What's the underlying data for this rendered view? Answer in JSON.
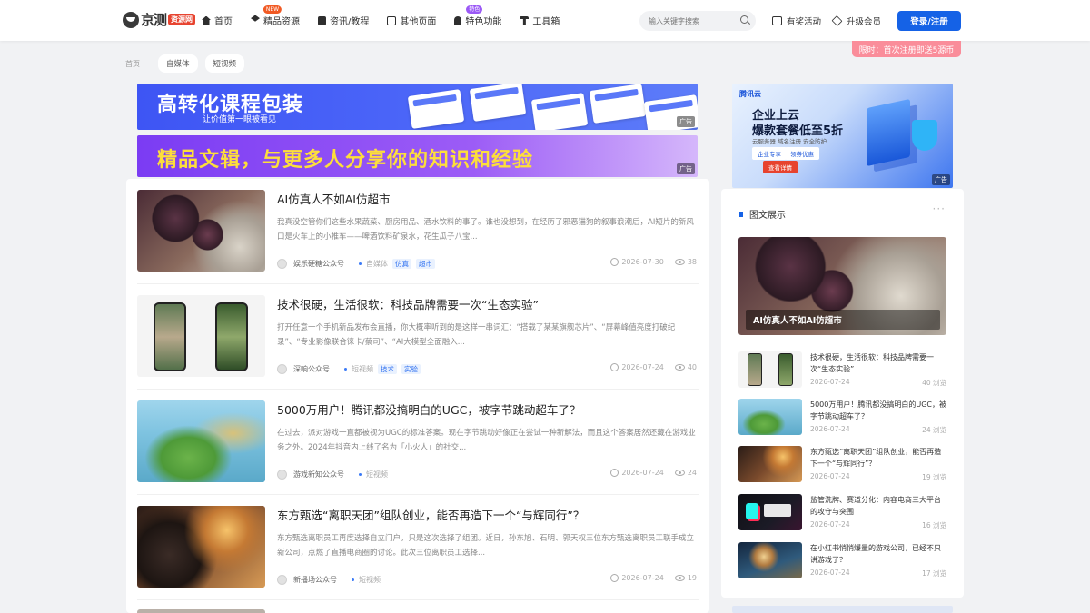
{
  "header": {
    "logo_text": "京测",
    "logo_badge": "资源网",
    "nav": [
      {
        "label": "首页",
        "icon": "home-icon"
      },
      {
        "label": "精品资源",
        "icon": "layers-icon",
        "tag": "NEW"
      },
      {
        "label": "资讯/教程",
        "icon": "document-icon"
      },
      {
        "label": "其他页面",
        "icon": "window-icon"
      },
      {
        "label": "特色功能",
        "icon": "bell-icon",
        "tag": "特色"
      },
      {
        "label": "工具箱",
        "icon": "tool-icon"
      }
    ],
    "search_placeholder": "输入关键字搜索",
    "reward_label": "有奖活动",
    "vip_label": "升级会员",
    "login_label": "登录/注册",
    "promo": "限时：首次注册即送5源币"
  },
  "breadcrumb": {
    "home": "首页",
    "tabs": [
      "自媒体",
      "短视频"
    ]
  },
  "banners": {
    "top_title": "高转化课程包装",
    "top_sub": "让价值第一眼被看见",
    "second_title": "精品文辑，与更多人分享你的知识和经验",
    "ad_label": "广告"
  },
  "posts": [
    {
      "title": "AI仿真人不如AI仿超市",
      "desc": "我真没空管你们这些水果蔬菜、厨房用品、酒水饮料的事了。谁也没想到，在经历了邪恶猫狗的叙事浪潮后，AI短片的新风口是火车上的小推车——啤酒饮料矿泉水，花生瓜子八宝...",
      "author": "娱乐硬糖公众号",
      "category": "自媒体",
      "tags": [
        "仿真",
        "超市"
      ],
      "date": "2026-07-30",
      "views": "38"
    },
    {
      "title": "技术很硬，生活很软：科技品牌需要一次“生态实验”",
      "desc": "打开任意一个手机新品发布会直播，你大概率听到的是这样一串词汇：“搭载了某某旗舰芯片”、“屏幕峰值亮度打破纪录”、“专业影像联合徕卡/蔡司”、“AI大模型全面融入...",
      "author": "深响公众号",
      "category": "短视频",
      "tags": [
        "技术",
        "实验"
      ],
      "date": "2026-07-24",
      "views": "40"
    },
    {
      "title": "5000万用户！腾讯都没搞明白的UGC，被字节跳动超车了？",
      "desc": "在过去，派对游戏一直都被视为UGC的标准答案。现在字节跳动好像正在尝试一种新解法，而且这个答案居然还藏在游戏业务之外。2024年抖音内上线了名为「小火人」的社交...",
      "author": "游戏新知公众号",
      "category": "短视频",
      "tags": [],
      "date": "2026-07-24",
      "views": "24"
    },
    {
      "title": "东方甄选“离职天团”组队创业，能否再造下一个“与辉同行”？",
      "desc": "东方甄选离职员工再度选择自立门户，只是这次选择了组团。近日，孙东旭、石明、郭天权三位东方甄选离职员工联手成立新公司，点燃了直播电商圈的讨论。此次三位离职员工选择...",
      "author": "新播场公众号",
      "category": "短视频",
      "tags": [],
      "date": "2026-07-24",
      "views": "19"
    }
  ],
  "side_ad": {
    "logo": "腾讯云",
    "line1": "企业上云",
    "line2": "爆款套餐低至5折",
    "sub": "云服务器 域名注册 安全防护",
    "btn1": "企业专享",
    "btn2": "领券优惠",
    "btn3": "查看详情",
    "ad_label": "广告"
  },
  "side_panel": {
    "title": "图文展示",
    "more": "···",
    "feature_caption": "AI仿真人不如AI仿超市",
    "items": [
      {
        "title": "技术很硬，生活很软：科技品牌需要一次“生态实验”",
        "date": "2026-07-24",
        "views": "40 浏览"
      },
      {
        "title": "5000万用户！腾讯都没搞明白的UGC，被字节跳动超车了？",
        "date": "2026-07-24",
        "views": "24 浏览"
      },
      {
        "title": "东方甄选“离职天团”组队创业，能否再造下一个“与辉同行”？",
        "date": "2026-07-24",
        "views": "19 浏览"
      },
      {
        "title": "监管洗牌、赛道分化：内容电商三大平台的攻守与突围",
        "date": "2026-07-24",
        "views": "16 浏览"
      },
      {
        "title": "在小红书悄悄爆量的游戏公司，已经不只讲游戏了？",
        "date": "2026-07-24",
        "views": "17 浏览"
      }
    ]
  }
}
